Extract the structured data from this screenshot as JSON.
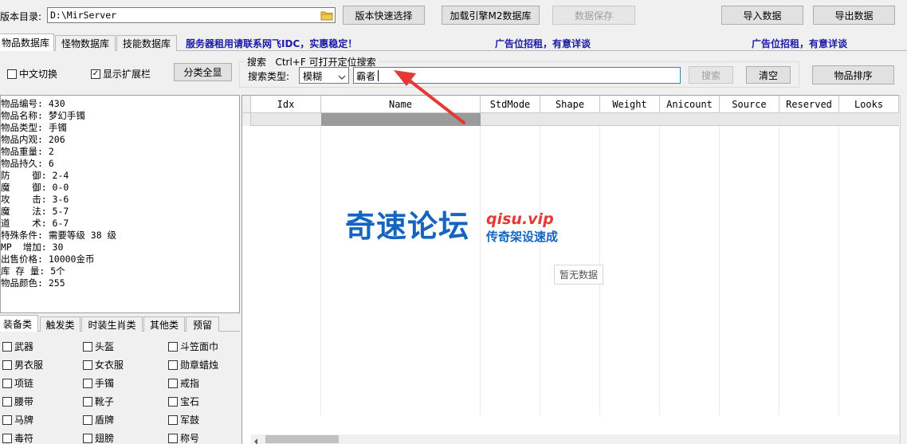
{
  "toolbar": {
    "dir_label": "版本目录:",
    "dir_value": "D:\\MirServer",
    "quick_select": "版本快速选择",
    "load_db": "加载引擎M2数据库",
    "save_data": "数据保存",
    "import_data": "导入数据",
    "export_data": "导出数据"
  },
  "tabs": [
    "物品数据库",
    "怪物数据库",
    "技能数据库"
  ],
  "ads": {
    "ad1": "服务器租用请联系网飞IDC，实惠稳定！",
    "ad2": "广告位招租，有意详谈",
    "ad3": "广告位招租，有意详谈"
  },
  "options": {
    "chinese_switch": "中文切换",
    "show_ext": "显示扩展栏",
    "category_all": "分类全显"
  },
  "search": {
    "group_title": "搜索   Ctrl+F 可打开定位搜索",
    "type_label": "搜索类型:",
    "type_value": "模糊",
    "query": "霸者",
    "search_btn": "搜索",
    "clear_btn": "清空",
    "sort_btn": "物品排序"
  },
  "item_info": [
    "物品编号: 430",
    "物品名称: 梦幻手镯",
    "物品类型: 手镯",
    "物品内观: 206",
    "物品重量: 2",
    "物品持久: 6",
    "防    御: 2-4",
    "魔    御: 0-0",
    "攻    击: 3-6",
    "魔    法: 5-7",
    "道    术: 6-7",
    "特殊条件: 需要等级 38 级",
    "MP  增加: 30",
    "出售价格: 10000金币",
    "库 存 量: 5个",
    "物品颜色: 255"
  ],
  "category_tabs": [
    "装备类",
    "触发类",
    "时装生肖类",
    "其他类",
    "预留"
  ],
  "categories": [
    "武器",
    "头盔",
    "斗笠面巾",
    "男衣服",
    "女衣服",
    "勋章蜡烛",
    "项链",
    "手镯",
    "戒指",
    "腰带",
    "靴子",
    "宝石",
    "马牌",
    "盾牌",
    "军鼓",
    "毒符",
    "翅膀",
    "称号"
  ],
  "grid": {
    "columns": [
      "Idx",
      "Name",
      "StdMode",
      "Shape",
      "Weight",
      "Anicount",
      "Source",
      "Reserved",
      "Looks"
    ],
    "empty_text": "暂无数据"
  },
  "watermark": {
    "main": "奇速论坛",
    "domain": "qisu.vip",
    "sub": "传奇架设速成"
  },
  "colors": {
    "ad_text": "#1a1aa6",
    "watermark_blue": "#1565c0",
    "watermark_red": "#e53935",
    "arrow_red": "#e53935",
    "selected_cell": "#9b9b9b"
  }
}
